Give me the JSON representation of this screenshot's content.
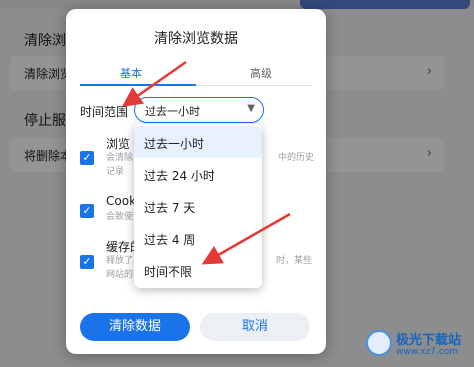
{
  "background": {
    "section1_heading": "清除浏",
    "card1_label": "清除浏览",
    "section2_heading": "停止服",
    "card2_label": "将删除本",
    "chevron": "›"
  },
  "dialog": {
    "title": "清除浏览数据",
    "tabs": [
      {
        "label": "基本",
        "active": true
      },
      {
        "label": "高级",
        "active": false
      }
    ],
    "time_range": {
      "label": "时间范围",
      "selected": "过去一小时"
    },
    "items": [
      {
        "title": "浏览",
        "desc_lines": [
          "会清除",
          "记录"
        ],
        "desc_right": "中的历史",
        "checked": true
      },
      {
        "title": "Cook",
        "desc_lines": [
          "会致使"
        ],
        "checked": true
      },
      {
        "title": "缓存的",
        "desc_lines": [
          "释放了",
          "网站的"
        ],
        "desc_right": "时，某些",
        "checked": true
      }
    ],
    "clear_button": "清除数据",
    "cancel_button": "取消"
  },
  "dropdown": {
    "options": [
      {
        "label": "过去一小时",
        "selected": true
      },
      {
        "label": "过去 24 小时",
        "selected": false
      },
      {
        "label": "过去 7 天",
        "selected": false
      },
      {
        "label": "过去 4 周",
        "selected": false
      },
      {
        "label": "时间不限",
        "selected": false
      }
    ]
  },
  "watermark": {
    "name": "极光下载站",
    "url": "www.xz7.com"
  },
  "colors": {
    "accent": "#1a73e8",
    "arrow": "#e53935"
  }
}
